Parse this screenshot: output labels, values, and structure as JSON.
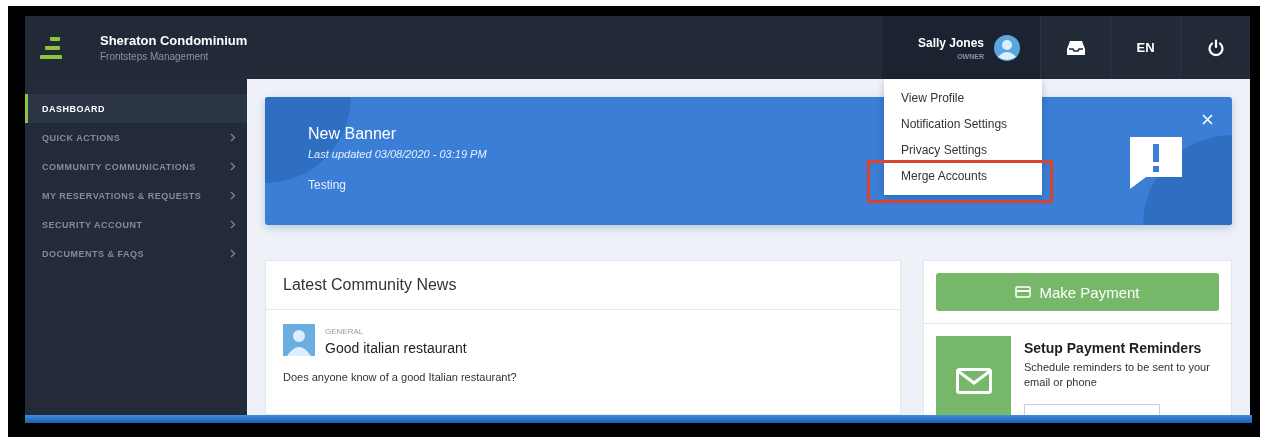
{
  "header": {
    "title": "Sheraton Condominium",
    "subtitle": "Frontsteps Management",
    "user": {
      "name": "Sally Jones",
      "role": "OWNER"
    },
    "language": "EN"
  },
  "sidebar": {
    "items": [
      {
        "label": "DASHBOARD",
        "selected": true,
        "expandable": false
      },
      {
        "label": "QUICK ACTIONS",
        "selected": false,
        "expandable": true
      },
      {
        "label": "COMMUNITY COMMUNICATIONS",
        "selected": false,
        "expandable": true
      },
      {
        "label": "MY RESERVATIONS & REQUESTS",
        "selected": false,
        "expandable": true
      },
      {
        "label": "SECURITY ACCOUNT",
        "selected": false,
        "expandable": true
      },
      {
        "label": "DOCUMENTS & FAQS",
        "selected": false,
        "expandable": true
      }
    ]
  },
  "user_menu": {
    "items": [
      {
        "label": "View Profile",
        "highlighted": false
      },
      {
        "label": "Notification Settings",
        "highlighted": false
      },
      {
        "label": "Privacy Settings",
        "highlighted": false
      },
      {
        "label": "Merge Accounts",
        "highlighted": true
      }
    ]
  },
  "banner": {
    "title": "New Banner",
    "updated": "Last updated 03/08/2020 - 03:19 PM",
    "body": "Testing"
  },
  "news": {
    "title": "Latest Community News",
    "posts": [
      {
        "category": "GENERAL",
        "title": "Good italian restaurant",
        "body": "Does anyone know of a good Italian restaurant?"
      }
    ]
  },
  "payment": {
    "button": "Make Payment",
    "reminders": {
      "title": "Setup Payment Reminders",
      "description": "Schedule reminders to be sent to your email or phone"
    }
  }
}
